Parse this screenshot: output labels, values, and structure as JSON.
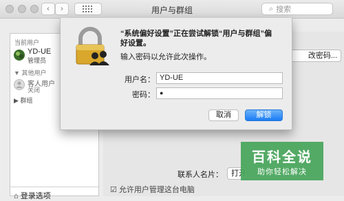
{
  "window": {
    "title": "用户与群组",
    "search_placeholder": "搜索"
  },
  "sidebar": {
    "current_users_header": "当前用户",
    "current_user": {
      "name": "YD-UE",
      "role": "管理员"
    },
    "other_users_header": "其他用户",
    "guest_user": {
      "name": "客人用户",
      "status": "关闭"
    },
    "groups_label": "群组",
    "login_options_label": "登录选项"
  },
  "main": {
    "change_password_button": "改密码...",
    "contacts_card_label": "联系人名片：",
    "open_button": "打开",
    "allow_admin_checkbox_label": "允许用户管理这台电脑",
    "allow_admin_checked": true
  },
  "dialog": {
    "message": "“系统偏好设置”正在尝试解锁“用户与群组”偏好设置。",
    "prompt": "输入密码以允许此次操作。",
    "username_label": "用户名：",
    "username_value": "YD-UE",
    "password_label": "密码：",
    "password_value": "●",
    "cancel_button": "取消",
    "unlock_button": "解锁"
  },
  "watermark": {
    "title": "百科全说",
    "subtitle": "助你轻松解决"
  }
}
